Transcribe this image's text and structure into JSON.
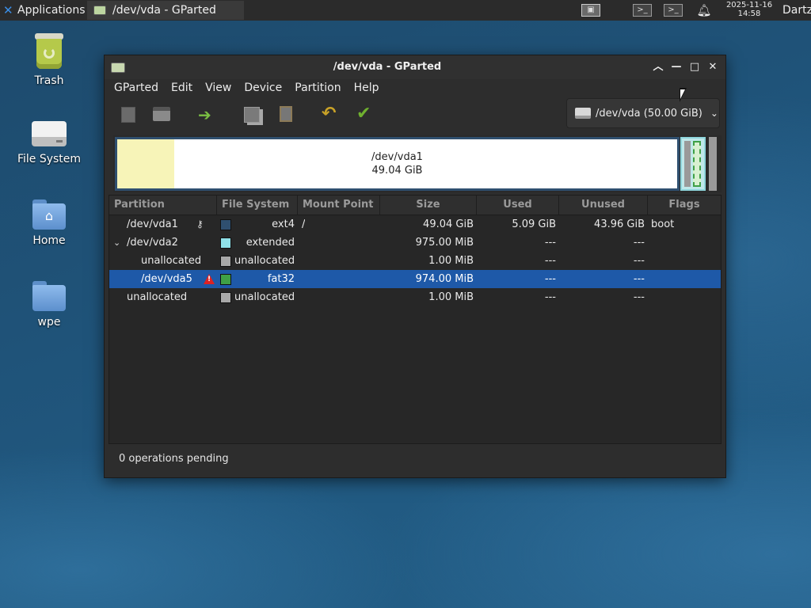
{
  "panel": {
    "applications_label": "Applications",
    "task_title": "/dev/vda - GParted",
    "clock_date": "2025-11-16",
    "clock_time": "14:58",
    "user": "Dartz"
  },
  "desktop": {
    "icons": [
      {
        "label": "Trash"
      },
      {
        "label": "File System"
      },
      {
        "label": "Home"
      },
      {
        "label": "wpe"
      }
    ]
  },
  "window": {
    "title": "/dev/vda - GParted",
    "menu": [
      "GParted",
      "Edit",
      "View",
      "Device",
      "Partition",
      "Help"
    ],
    "device_selector": "/dev/vda (50.00 GiB)",
    "disk_map": {
      "primary_label": "/dev/vda1",
      "primary_size": "49.04 GiB"
    },
    "columns": [
      "Partition",
      "File System",
      "Mount Point",
      "Size",
      "Used",
      "Unused",
      "Flags"
    ],
    "rows": [
      {
        "partition": "/dev/vda1",
        "fs": "ext4",
        "mount": "/",
        "size": "49.04 GiB",
        "used": "5.09 GiB",
        "unused": "43.96 GiB",
        "flags": "boot",
        "fs_color": "#2f4f6f"
      },
      {
        "partition": "/dev/vda2",
        "fs": "extended",
        "mount": "",
        "size": "975.00 MiB",
        "used": "---",
        "unused": "---",
        "flags": "",
        "fs_color": "#8fe0e8"
      },
      {
        "partition": "unallocated",
        "fs": "unallocated",
        "mount": "",
        "size": "1.00 MiB",
        "used": "---",
        "unused": "---",
        "flags": "",
        "fs_color": "#a8a8a8"
      },
      {
        "partition": "/dev/vda5",
        "fs": "fat32",
        "mount": "",
        "size": "974.00 MiB",
        "used": "---",
        "unused": "---",
        "flags": "",
        "fs_color": "#3fa046"
      },
      {
        "partition": "unallocated",
        "fs": "unallocated",
        "mount": "",
        "size": "1.00 MiB",
        "used": "---",
        "unused": "---",
        "flags": "",
        "fs_color": "#a8a8a8"
      }
    ],
    "status": "0 operations pending"
  }
}
